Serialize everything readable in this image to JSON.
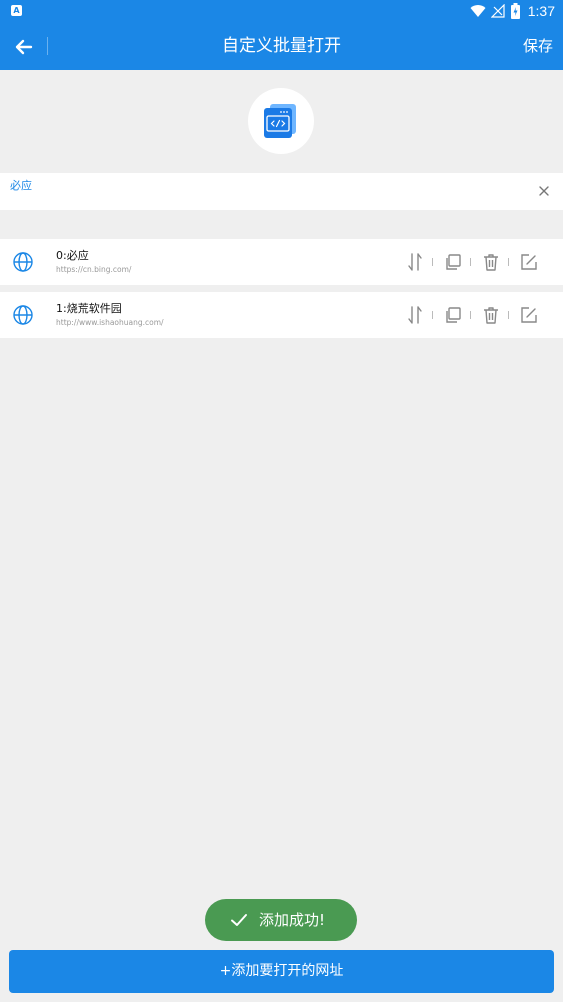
{
  "statusbar": {
    "time": "1:37",
    "notification_badge": "A"
  },
  "appbar": {
    "title": "自定义批量打开",
    "save_label": "保存"
  },
  "search": {
    "value": "必应"
  },
  "items": [
    {
      "title": "0:必应",
      "url": "https://cn.bing.com/"
    },
    {
      "title": "1:烧荒软件园",
      "url": "http://www.ishaohuang.com/"
    }
  ],
  "toast": {
    "text": "添加成功!"
  },
  "footer": {
    "add_label": "+添加要打开的网址"
  },
  "colors": {
    "primary": "#1b87e6",
    "toast": "#4a9a52",
    "background": "#efefef"
  }
}
